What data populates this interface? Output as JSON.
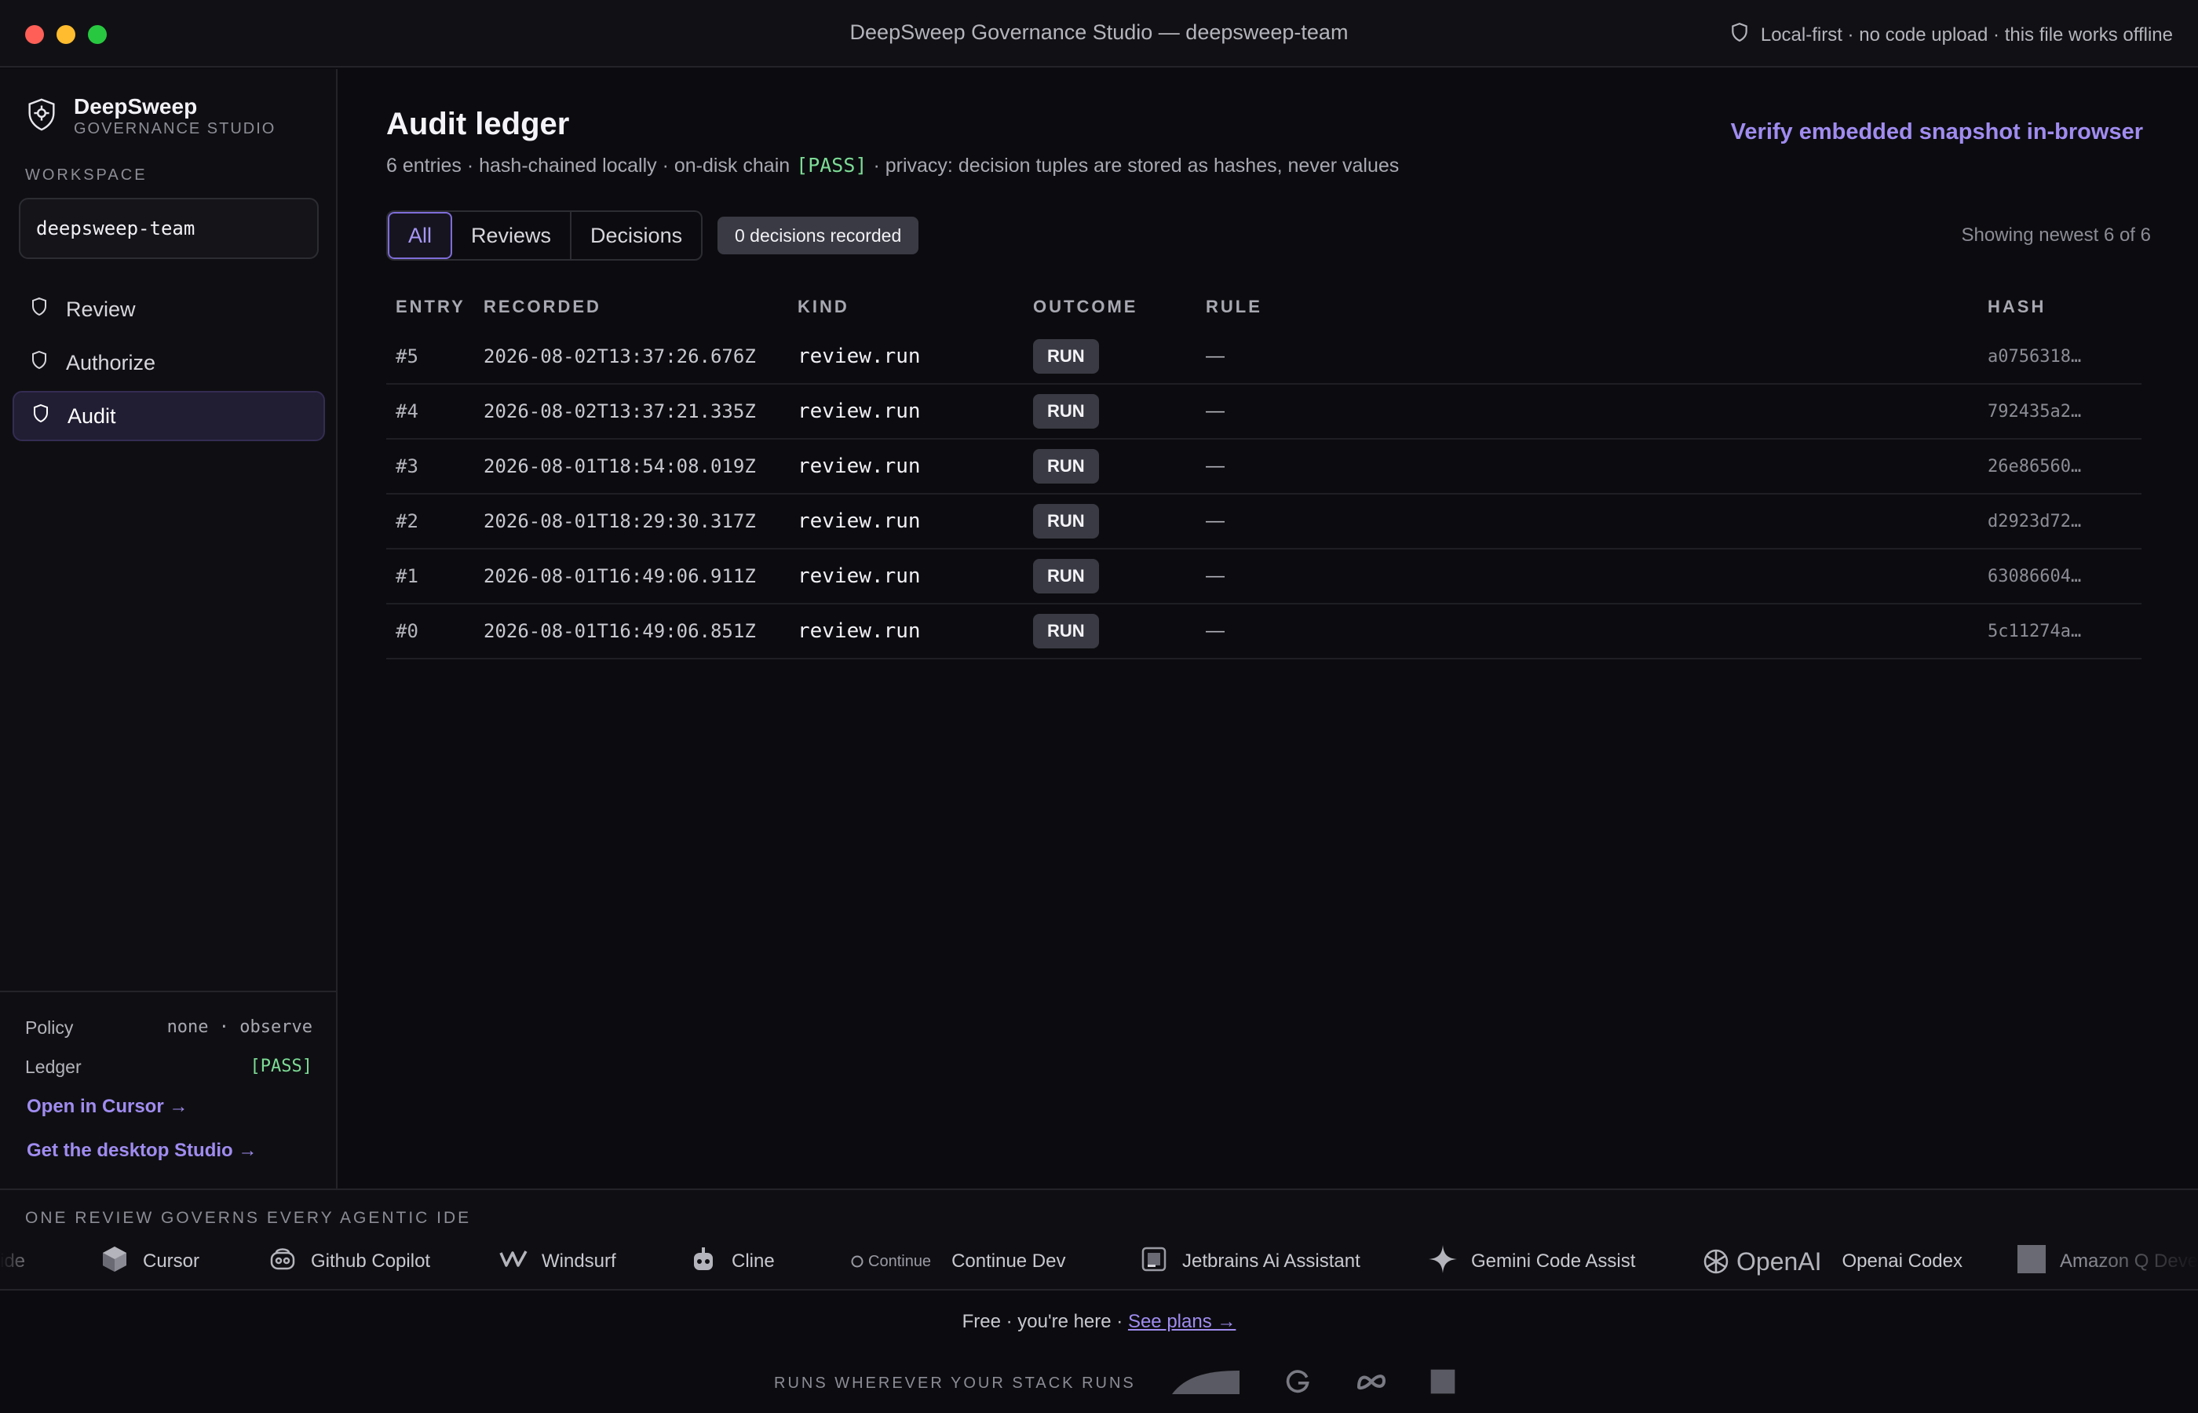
{
  "window": {
    "title": "DeepSweep Governance Studio — deepsweep-team",
    "status": "Local-first · no code upload · this file works offline"
  },
  "sidebar": {
    "brand_name": "DeepSweep",
    "brand_sub": "GOVERNANCE STUDIO",
    "workspace_label": "WORKSPACE",
    "workspace_value": "deepsweep-team",
    "nav": [
      {
        "label": "Review",
        "active": false
      },
      {
        "label": "Authorize",
        "active": false
      },
      {
        "label": "Audit",
        "active": true
      }
    ],
    "policy_key": "Policy",
    "policy_value": "none · observe",
    "ledger_key": "Ledger",
    "ledger_value": "[PASS]",
    "open_cursor": "Open in Cursor →",
    "get_desktop": "Get the desktop Studio →"
  },
  "main": {
    "title": "Audit ledger",
    "subtitle_pre": "6 entries · hash-chained locally · on-disk chain",
    "subtitle_pass": "[PASS]",
    "subtitle_post": "· privacy: decision tuples are stored as hashes, never values",
    "verify_link": "Verify embedded snapshot in-browser",
    "tabs": [
      {
        "label": "All",
        "active": true
      },
      {
        "label": "Reviews",
        "active": false
      },
      {
        "label": "Decisions",
        "active": false
      }
    ],
    "badge": "0 decisions recorded",
    "showing": "Showing newest 6 of 6",
    "columns": [
      "ENTRY",
      "RECORDED",
      "KIND",
      "OUTCOME",
      "RULE",
      "HASH"
    ],
    "rows": [
      {
        "entry": "#5",
        "recorded": "2026-08-02T13:37:26.676Z",
        "kind": "review.run",
        "outcome": "RUN",
        "rule": "—",
        "hash": "a0756318…"
      },
      {
        "entry": "#4",
        "recorded": "2026-08-02T13:37:21.335Z",
        "kind": "review.run",
        "outcome": "RUN",
        "rule": "—",
        "hash": "792435a2…"
      },
      {
        "entry": "#3",
        "recorded": "2026-08-01T18:54:08.019Z",
        "kind": "review.run",
        "outcome": "RUN",
        "rule": "—",
        "hash": "26e86560…"
      },
      {
        "entry": "#2",
        "recorded": "2026-08-01T18:29:30.317Z",
        "kind": "review.run",
        "outcome": "RUN",
        "rule": "—",
        "hash": "d2923d72…"
      },
      {
        "entry": "#1",
        "recorded": "2026-08-01T16:49:06.911Z",
        "kind": "review.run",
        "outcome": "RUN",
        "rule": "—",
        "hash": "63086604…"
      },
      {
        "entry": "#0",
        "recorded": "2026-08-01T16:49:06.851Z",
        "kind": "review.run",
        "outcome": "RUN",
        "rule": "—",
        "hash": "5c11274a…"
      }
    ]
  },
  "ide_strip": {
    "label": "ONE REVIEW GOVERNS EVERY AGENTIC IDE",
    "partial_left": "ide",
    "items": [
      {
        "name": "Cursor",
        "icon": "cube-icon"
      },
      {
        "name": "Github Copilot",
        "icon": "copilot-icon"
      },
      {
        "name": "Windsurf",
        "icon": "windsurf-icon"
      },
      {
        "name": "Cline",
        "icon": "robot-icon"
      },
      {
        "name": "Continue Dev",
        "icon": "continue-logo",
        "logo_text": "Continue"
      },
      {
        "name": "Jetbrains Ai Assistant",
        "icon": "jetbrains-icon"
      },
      {
        "name": "Gemini Code Assist",
        "icon": "sparkle-icon"
      },
      {
        "name": "Openai Codex",
        "icon": "openai-logo",
        "logo_text": "OpenAI"
      },
      {
        "name": "Amazon Q Developer",
        "icon": "amazon-q-icon"
      }
    ]
  },
  "footer": {
    "free_text": "Free · you're here ·",
    "see_plans": "See plans →",
    "runs_label": "RUNS WHEREVER YOUR STACK RUNS"
  }
}
